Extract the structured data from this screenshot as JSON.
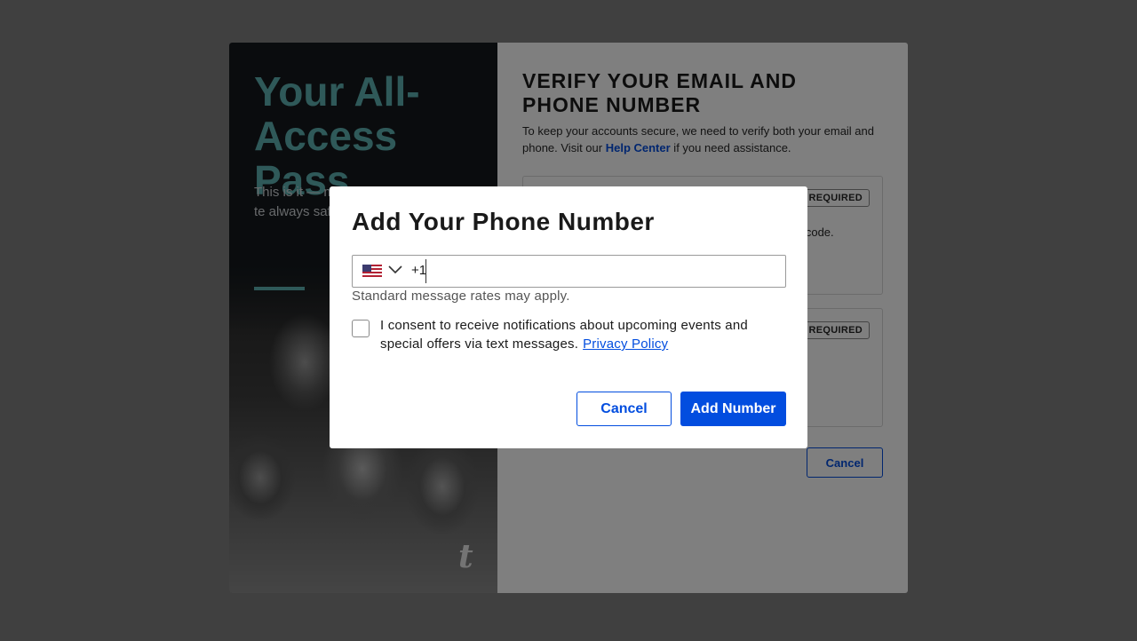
{
  "hero": {
    "title": "Your All-Access Pass",
    "body": "This is it — m to the minute artists and te always safe, s"
  },
  "verify": {
    "title": "VERIFY YOUR EMAIL AND PHONE NUMBER",
    "desc_before": "To keep your accounts secure, we need to verify both your email and phone. Visit our ",
    "help_link": "Help Center",
    "desc_after": " if you need assistance.",
    "required_label": "REQUIRED",
    "fragment_text": "e code.",
    "cancel_label": "Cancel"
  },
  "modal": {
    "title": "Add Your Phone Number",
    "country_flag": "us-flag-icon",
    "dial_code": "+1",
    "phone_value": "",
    "rates_note": "Standard message rates may apply.",
    "consent_text": "I consent to receive notifications about upcoming events and special offers via text messages.",
    "privacy_link": "Privacy Policy",
    "consent_checked": false,
    "cancel_label": "Cancel",
    "add_label": "Add Number"
  },
  "colors": {
    "accent": "#024ddf",
    "hero_teal": "#5fb3b3",
    "hero_bg": "#14191d"
  }
}
